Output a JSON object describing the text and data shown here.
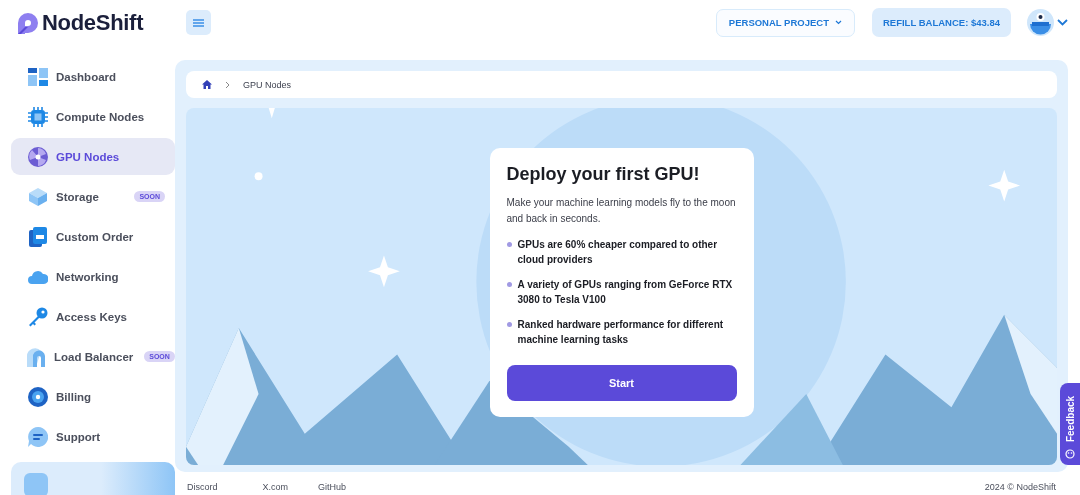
{
  "brand": {
    "name": "NodeShift"
  },
  "header": {
    "project": "PERSONAL PROJECT",
    "balance": "REFILL BALANCE: $43.84"
  },
  "sidebar": {
    "items": [
      {
        "label": "Dashboard",
        "selected": false
      },
      {
        "label": "Compute Nodes",
        "selected": false
      },
      {
        "label": "GPU Nodes",
        "selected": true
      },
      {
        "label": "Storage",
        "selected": false,
        "badge": "SOON"
      },
      {
        "label": "Custom Order",
        "selected": false
      },
      {
        "label": "Networking",
        "selected": false
      },
      {
        "label": "Access Keys",
        "selected": false
      },
      {
        "label": "Load Balancer",
        "selected": false,
        "badge": "SOON"
      },
      {
        "label": "Billing",
        "selected": false
      },
      {
        "label": "Support",
        "selected": false
      }
    ]
  },
  "breadcrumb": [
    "GPU Nodes"
  ],
  "card": {
    "title": "Deploy your first GPU!",
    "text": "Make your machine learning models fly to the moon and back in seconds.",
    "bullets": [
      "GPUs are 60% cheaper compared to other cloud providers",
      "A variety of GPUs ranging from GeForce RTX 3080 to Tesla V100",
      "Ranked hardware performance for different machine learning tasks"
    ],
    "button": "Start"
  },
  "feedback": "Feedback",
  "footer": {
    "links": [
      "Discord",
      "X.com",
      "GitHub"
    ],
    "copyright": "2024 © NodeShift"
  }
}
